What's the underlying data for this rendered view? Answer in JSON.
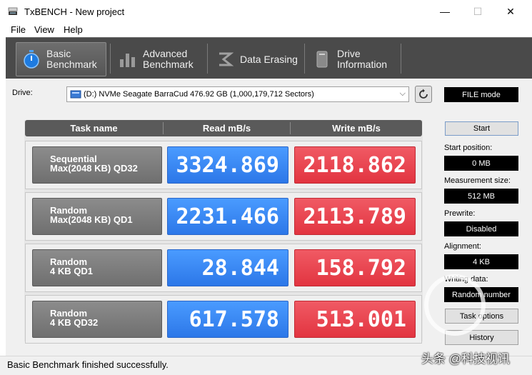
{
  "window": {
    "title": "TxBENCH - New project",
    "min_label": "—",
    "max_label": "☐",
    "close_label": "✕"
  },
  "menu": {
    "items": [
      "File",
      "View",
      "Help"
    ]
  },
  "toolbar": {
    "tabs": [
      {
        "label": "Basic\nBenchmark",
        "icon": "stopwatch-icon",
        "active": true
      },
      {
        "label": "Advanced\nBenchmark",
        "icon": "bar-chart-icon",
        "active": false
      },
      {
        "label": "Data Erasing",
        "icon": "eraser-icon",
        "active": false
      },
      {
        "label": "Drive\nInformation",
        "icon": "drive-icon",
        "active": false
      }
    ]
  },
  "drive": {
    "label": "Drive:",
    "selected": "(D:) NVMe Seagate BarraCud  476.92 GB (1,000,179,712 Sectors)",
    "chevron": "⌵"
  },
  "table": {
    "headers": {
      "task": "Task name",
      "read": "Read mB/s",
      "write": "Write mB/s"
    },
    "rows": [
      {
        "task_line1": "Sequential",
        "task_line2": "Max(2048 KB) QD32",
        "read": "3324.869",
        "write": "2118.862"
      },
      {
        "task_line1": "Random",
        "task_line2": "Max(2048 KB) QD1",
        "read": "2231.466",
        "write": "2113.789"
      },
      {
        "task_line1": "Random",
        "task_line2": "4 KB QD1",
        "read": "28.844",
        "write": "158.792"
      },
      {
        "task_line1": "Random",
        "task_line2": "4 KB QD32",
        "read": "617.578",
        "write": "513.001"
      }
    ]
  },
  "side": {
    "mode_label": "FILE mode",
    "start_label": "Start",
    "start_position_label": "Start position:",
    "start_position_value": "0 MB",
    "measurement_size_label": "Measurement size:",
    "measurement_size_value": "512 MB",
    "prewrite_label": "Prewrite:",
    "prewrite_value": "Disabled",
    "alignment_label": "Alignment:",
    "alignment_value": "4 KB",
    "writing_data_label": "Writing data:",
    "writing_data_value": "Random number",
    "task_options_label": "Task options",
    "history_label": "History"
  },
  "status": {
    "text": "Basic Benchmark finished successfully."
  },
  "watermark": {
    "text": "头条 @科技视讯"
  }
}
